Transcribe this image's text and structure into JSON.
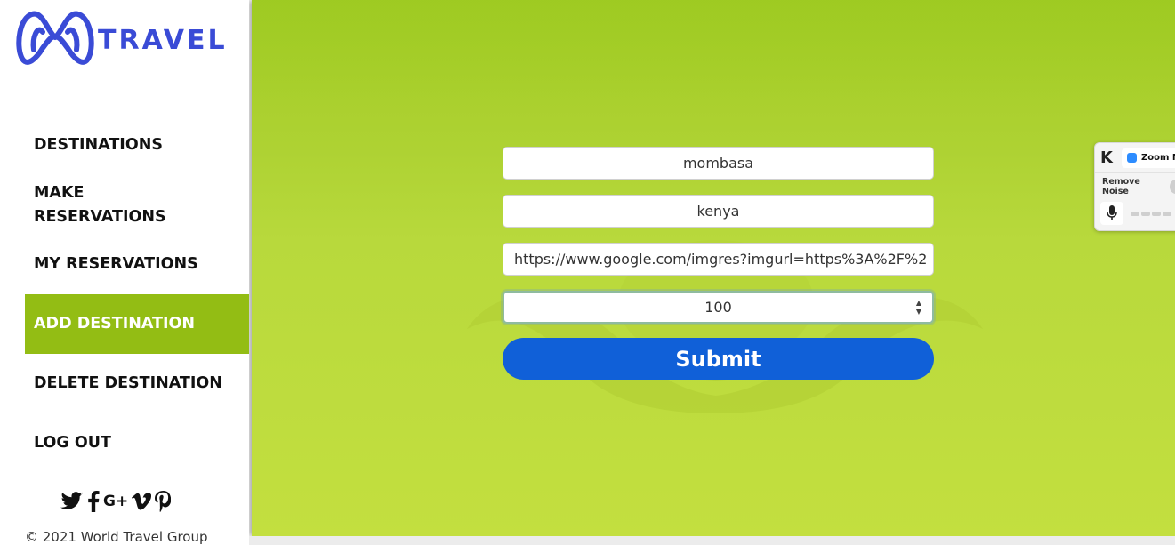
{
  "brand": {
    "name": "TRAVEL",
    "accent": "#93bd14",
    "logo_color": "#3a4bd6"
  },
  "nav": {
    "items": [
      {
        "label": "DESTINATIONS",
        "active": false
      },
      {
        "label_line1": "MAKE",
        "label_line2": "RESERVATIONS",
        "active": false
      },
      {
        "label": "MY RESERVATIONS",
        "active": false
      },
      {
        "label": "ADD DESTINATION",
        "active": true
      },
      {
        "label": "DELETE DESTINATION",
        "active": false
      },
      {
        "label": "LOG OUT",
        "active": false
      }
    ]
  },
  "social": {
    "icons": [
      "twitter-icon",
      "facebook-icon",
      "google-plus-icon",
      "vimeo-icon",
      "pinterest-icon"
    ],
    "google_plus_text": "G+"
  },
  "footer": {
    "copyright": "© 2021 World Travel Group"
  },
  "form": {
    "name_value": "mombasa",
    "country_value": "kenya",
    "image_url_value": "https://www.google.com/imgres?imgurl=https%3A%2F%2",
    "price_value": "100",
    "submit_label": "Submit",
    "submit_color": "#1060d8"
  },
  "zoom_widget": {
    "app_badge": "K",
    "tab_label": "Zoom M",
    "remove_noise_label": "Remove Noise"
  }
}
